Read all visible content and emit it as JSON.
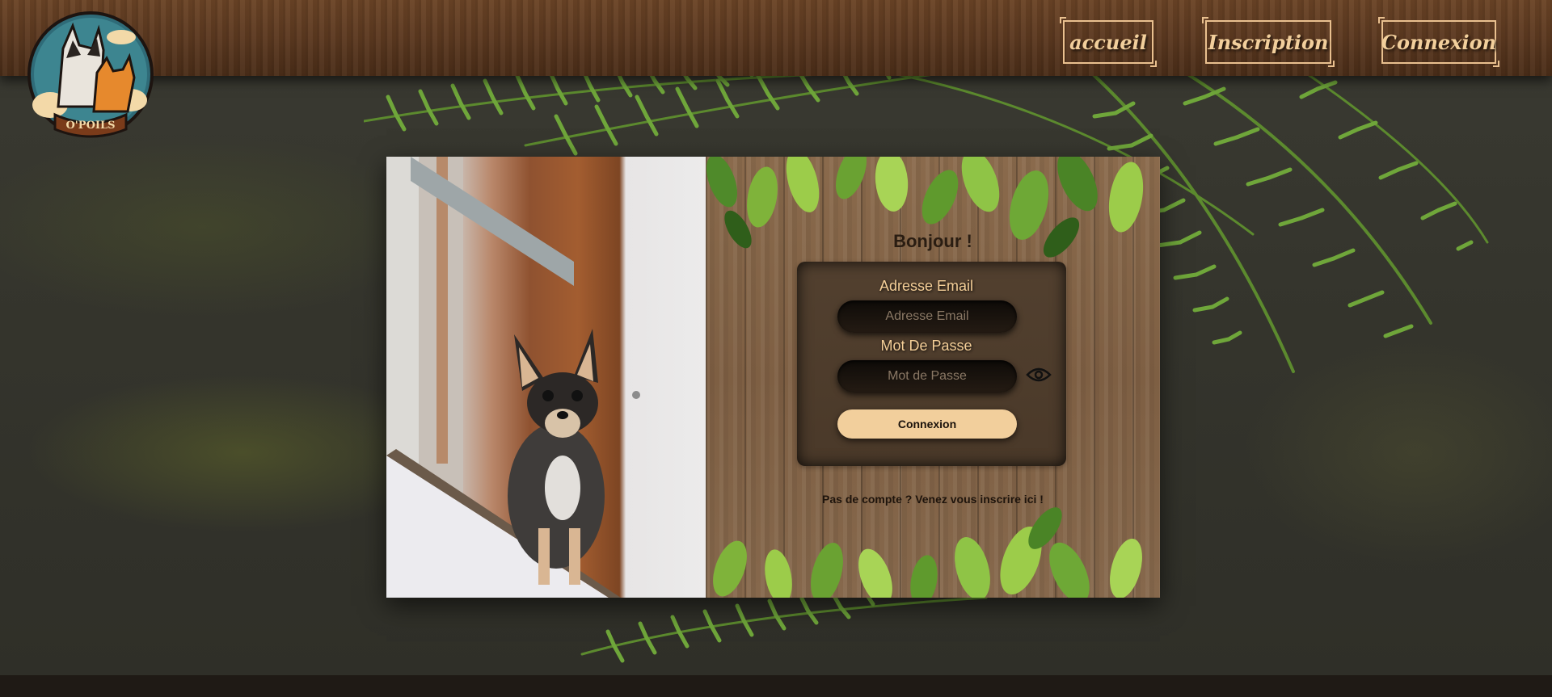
{
  "brand": {
    "logo_text": "O'POILS"
  },
  "nav": {
    "home_label": "accueil",
    "signup_label": "Inscription",
    "login_label": "Connexion"
  },
  "login": {
    "greeting": "Bonjour !",
    "email": {
      "label": "Adresse Email",
      "placeholder": "Adresse Email",
      "value": ""
    },
    "password": {
      "label": "Mot De Passe",
      "placeholder": "Mot de Passe",
      "value": ""
    },
    "submit_label": "Connexion",
    "signup_prompt": "Pas de compte ? Venez vous inscrire ici !"
  },
  "icons": {
    "password_toggle": "eye-icon"
  },
  "colors": {
    "accent": "#f2cf9c",
    "wood_header": "#5c3920",
    "form_box": "#4f3d2d",
    "leaf_green": "#7fb33a"
  }
}
